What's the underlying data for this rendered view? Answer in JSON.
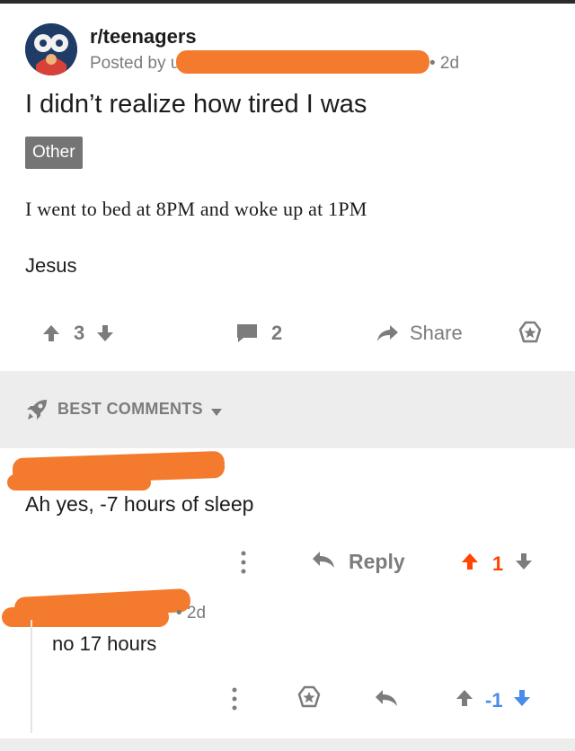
{
  "post": {
    "subreddit": "r/teenagers",
    "posted_by_prefix": "Posted by u/",
    "age": "• 2d",
    "title": "I didn’t realize how tired I was",
    "flair": "Other",
    "body": [
      "I went to bed at 8PM and woke up at 1PM",
      "Jesus"
    ],
    "score": "3",
    "comments_count": "2",
    "share_label": "Share"
  },
  "sort": {
    "label": "BEST COMMENTS"
  },
  "comments": [
    {
      "text": "Ah yes, -7 hours of sleep",
      "reply_label": "Reply",
      "score": "1"
    },
    {
      "age": "• 2d",
      "text": "no 17 hours",
      "score": "-1"
    }
  ],
  "colors": {
    "accent_upvote": "#ff4500",
    "downvote_blue": "#4a8bea",
    "redaction": "#f47a2e",
    "muted": "#7c7c7c"
  }
}
